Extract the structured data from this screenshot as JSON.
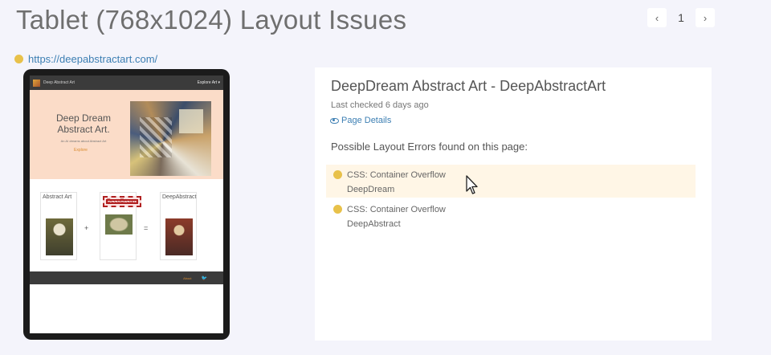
{
  "header": {
    "title": "Tablet (768x1024) Layout Issues",
    "pager": {
      "prev": "‹",
      "page": "1",
      "next": "›"
    }
  },
  "site": {
    "url": "https://deepabstractart.com/",
    "status_color": "#e8c14a"
  },
  "preview": {
    "nav_site": "Deep Abstract Art",
    "nav_explore": "Explore Art ▾",
    "hero_title": "Deep Dream Abstract Art.",
    "hero_sub": "An AI dreams about Abstract Art",
    "hero_cta": "Explore",
    "cards": [
      "Abstract Art",
      "DeepDream",
      "DeepAbstract"
    ],
    "op_plus": "+",
    "op_eq": "=",
    "footer_about": "About",
    "footer_twitter": "🐦"
  },
  "panel": {
    "title": "DeepDream Abstract Art - DeepAbstractArt",
    "last_checked": "Last checked 6 days ago",
    "details_link": "Page Details",
    "errors_heading": "Possible Layout Errors found on this page:",
    "errors": [
      {
        "type": "CSS: Container Overflow",
        "element": "DeepDream"
      },
      {
        "type": "CSS: Container Overflow",
        "element": "DeepAbstract"
      }
    ]
  }
}
